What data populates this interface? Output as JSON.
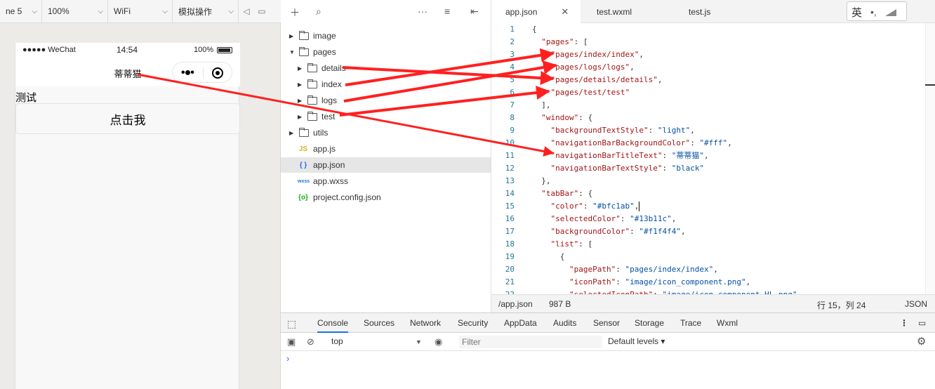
{
  "simulator": {
    "toolbar": {
      "device": "ne 5",
      "zoom": "100%",
      "network": "WiFi",
      "mode": "模拟操作"
    },
    "status": {
      "signal": "●●●●● WeChat",
      "time": "14:54",
      "battery": "100%"
    },
    "nav_title": "蒂蒂猫",
    "page_text": "测试",
    "page_button": "点击我"
  },
  "file_tree": [
    {
      "label": "image",
      "type": "folder",
      "expanded": false
    },
    {
      "label": "pages",
      "type": "folder",
      "expanded": true
    },
    {
      "label": "details",
      "type": "folder",
      "expanded": false
    },
    {
      "label": "index",
      "type": "folder",
      "expanded": false
    },
    {
      "label": "logs",
      "type": "folder",
      "expanded": false
    },
    {
      "label": "test",
      "type": "folder",
      "expanded": false
    },
    {
      "label": "utils",
      "type": "folder",
      "expanded": false
    },
    {
      "label": "app.js",
      "type": "js",
      "icon_text": "JS"
    },
    {
      "label": "app.json",
      "type": "json",
      "icon_text": "{ }"
    },
    {
      "label": "app.wxss",
      "type": "wxss",
      "icon_text": "wxss"
    },
    {
      "label": "project.config.json",
      "type": "config",
      "icon_text": "{o}"
    }
  ],
  "editor": {
    "tabs": [
      {
        "label": "app.json",
        "active": true
      },
      {
        "label": "test.wxml",
        "active": false
      },
      {
        "label": "test.js",
        "active": false
      }
    ],
    "ime_char": "英",
    "ime_dot": "•,",
    "lines": [
      {
        "n": "1",
        "text": "{"
      },
      {
        "n": "2",
        "text": "  \"pages\": ["
      },
      {
        "n": "3",
        "text": "    \"pages/index/index\","
      },
      {
        "n": "4",
        "text": "    \"pages/logs/logs\","
      },
      {
        "n": "5",
        "text": "    \"pages/details/details\","
      },
      {
        "n": "6",
        "text": "    \"pages/test/test\""
      },
      {
        "n": "7",
        "text": "  ],"
      },
      {
        "n": "8",
        "text": "  \"window\": {"
      },
      {
        "n": "9",
        "text": "    \"backgroundTextStyle\": \"light\","
      },
      {
        "n": "10",
        "text": "    \"navigationBarBackgroundColor\": \"#fff\","
      },
      {
        "n": "11",
        "text": "    \"navigationBarTitleText\": \"蒂蒂猫\","
      },
      {
        "n": "12",
        "text": "    \"navigationBarTextStyle\": \"black\""
      },
      {
        "n": "13",
        "text": "  },"
      },
      {
        "n": "14",
        "text": "  \"tabBar\": {"
      },
      {
        "n": "15",
        "text": "    \"color\": \"#bfc1ab\","
      },
      {
        "n": "16",
        "text": "    \"selectedColor\": \"#13b11c\","
      },
      {
        "n": "17",
        "text": "    \"backgroundColor\": \"#f1f4f4\","
      },
      {
        "n": "18",
        "text": "    \"list\": ["
      },
      {
        "n": "19",
        "text": "      {"
      },
      {
        "n": "20",
        "text": "        \"pagePath\": \"pages/index/index\","
      },
      {
        "n": "21",
        "text": "        \"iconPath\": \"image/icon_component.png\","
      },
      {
        "n": "22",
        "text": "        \"selectedIconPath\": \"image/icon_component_HL.png\","
      }
    ],
    "status": {
      "path": "/app.json",
      "size": "987 B",
      "position": "行 15，列 24",
      "language": "JSON"
    }
  },
  "devtools": {
    "tabs": [
      "Console",
      "Sources",
      "Network",
      "Security",
      "AppData",
      "Audits",
      "Sensor",
      "Storage",
      "Trace",
      "Wxml"
    ],
    "active_tab": "Console",
    "context": "top",
    "filter_placeholder": "Filter",
    "levels": "Default levels ▾",
    "prompt": "›"
  },
  "colors": {
    "annotation_arrow": "#ff2020",
    "json_key": "#a31515",
    "json_string": "#0451a5",
    "line_number": "#237893"
  }
}
